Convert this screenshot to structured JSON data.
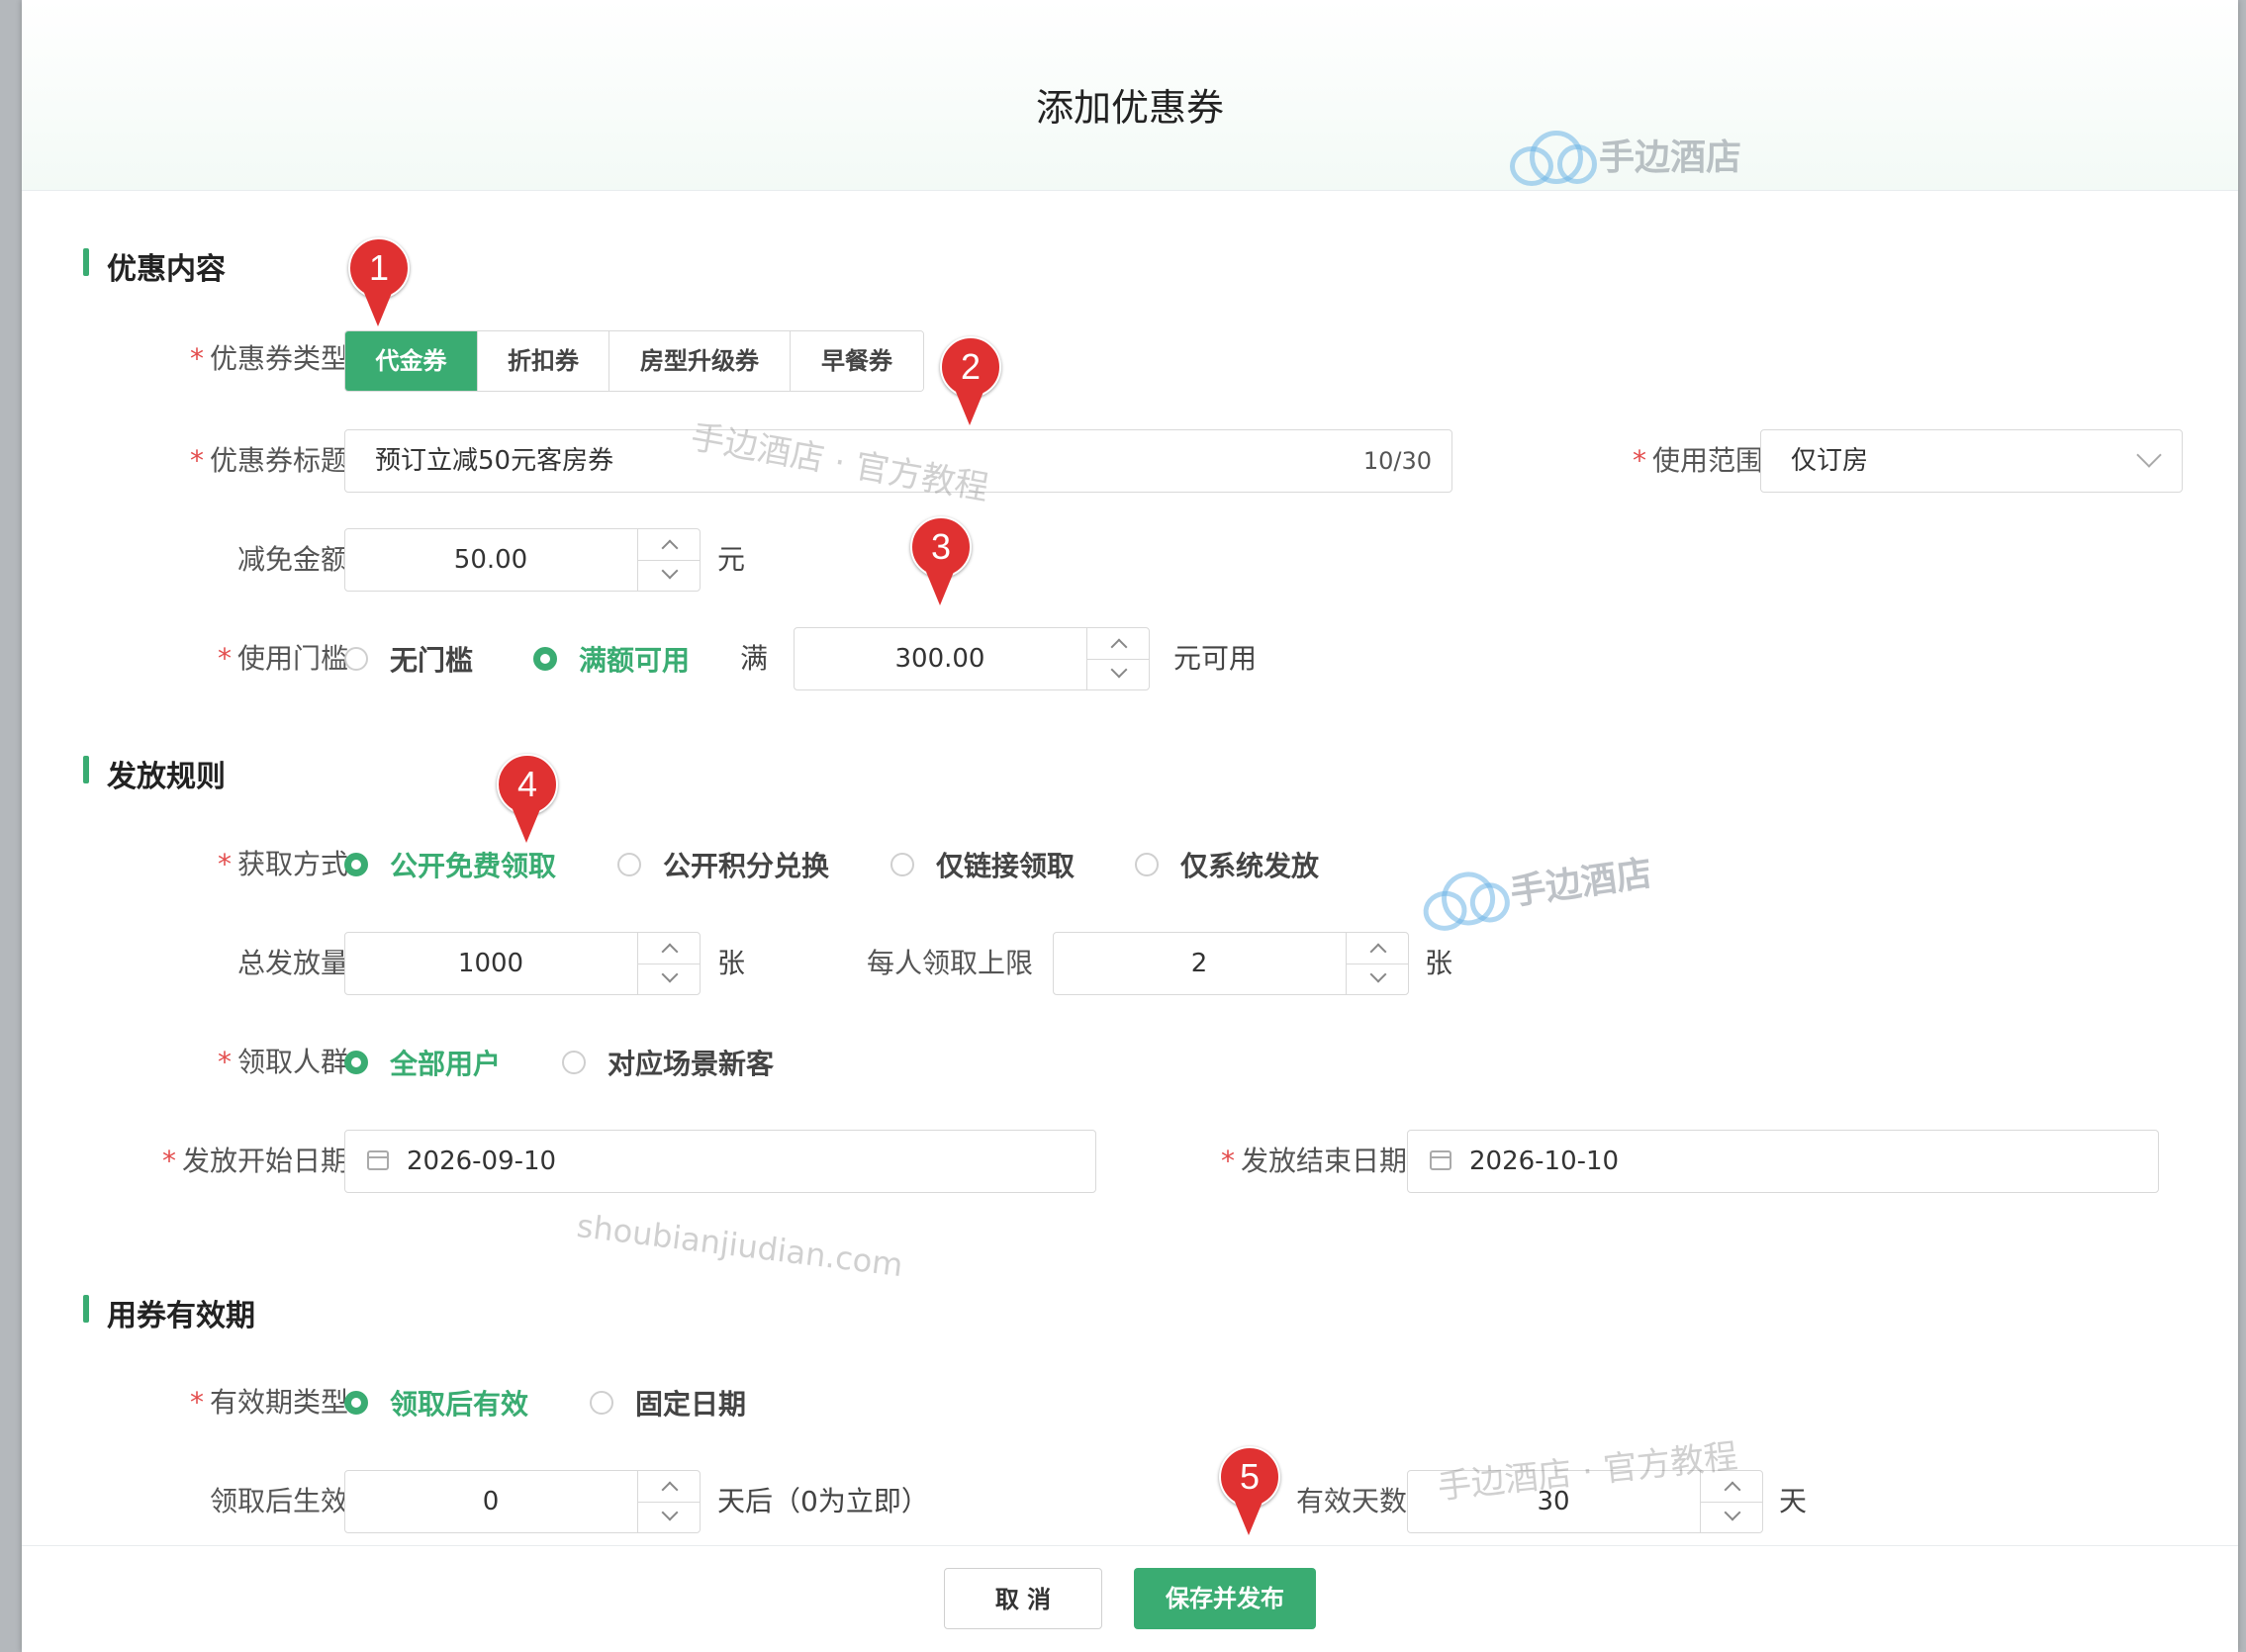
{
  "modal": {
    "title": "添加优惠券"
  },
  "sections": {
    "content": "优惠内容",
    "issue": "发放规则",
    "validity": "用券有效期"
  },
  "coupon_type": {
    "label": "优惠券类型",
    "options": [
      "代金券",
      "折扣券",
      "房型升级券",
      "早餐券"
    ],
    "selected": "代金券"
  },
  "coupon_title": {
    "label": "优惠券标题",
    "value": "预订立减50元客房券",
    "counter": "10/30"
  },
  "usage_scope": {
    "label": "使用范围",
    "value": "仅订房"
  },
  "discount_amount": {
    "label": "减免金额",
    "value": "50.00",
    "unit": "元"
  },
  "threshold": {
    "label": "使用门槛",
    "options": [
      "无门槛",
      "满额可用"
    ],
    "selected": "满额可用",
    "prefix": "满",
    "value": "300.00",
    "suffix": "元可用"
  },
  "acquire_method": {
    "label": "获取方式",
    "options": [
      "公开免费领取",
      "公开积分兑换",
      "仅链接领取",
      "仅系统发放"
    ],
    "selected": "公开免费领取"
  },
  "total_issue": {
    "label": "总发放量",
    "value": "1000",
    "unit": "张"
  },
  "per_user_limit": {
    "label": "每人领取上限",
    "value": "2",
    "unit": "张"
  },
  "audience": {
    "label": "领取人群",
    "options": [
      "全部用户",
      "对应场景新客"
    ],
    "selected": "全部用户"
  },
  "issue_start": {
    "label": "发放开始日期",
    "value": "2026-09-10"
  },
  "issue_end": {
    "label": "发放结束日期",
    "value": "2026-10-10"
  },
  "validity_type": {
    "label": "有效期类型",
    "options": [
      "领取后有效",
      "固定日期"
    ],
    "selected": "领取后有效"
  },
  "effective_after": {
    "label": "领取后生效",
    "value": "0",
    "unit": "天后（0为立即）"
  },
  "valid_days": {
    "label": "有效天数",
    "value": "30",
    "unit": "天"
  },
  "footer": {
    "cancel": "取 消",
    "save": "保存并发布"
  },
  "markers": [
    "1",
    "2",
    "3",
    "4",
    "5"
  ],
  "watermarks": {
    "brand": "手边酒店",
    "tutorial": "手边酒店 · 官方教程",
    "domain": "shoubianjiudian.com"
  },
  "colors": {
    "accent": "#3aac72",
    "marker": "#e03131",
    "required": "#e34d4d"
  }
}
